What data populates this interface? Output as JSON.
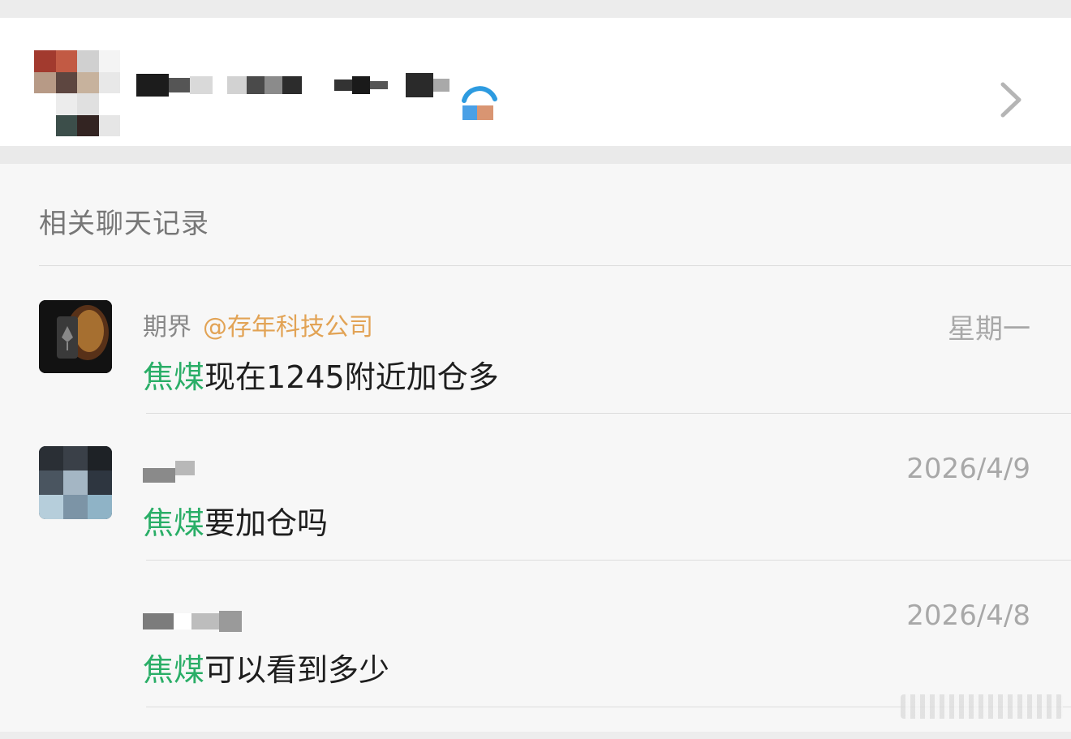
{
  "contact": {
    "name_redacted": true
  },
  "section": {
    "title": "相关聊天记录"
  },
  "results": [
    {
      "sender": "期界",
      "mention": "@存年科技公司",
      "time": "星期一",
      "keyword": "焦煤",
      "message": "现在1245附近加仓多"
    },
    {
      "sender": "",
      "mention": "",
      "time": "2026/4/9",
      "keyword": "焦煤",
      "message": "要加仓吗"
    },
    {
      "sender": "",
      "mention": "",
      "time": "2026/4/8",
      "keyword": "焦煤",
      "message": "可以看到多少"
    }
  ],
  "colors": {
    "highlight": "#2aae67",
    "mention": "#e2a355",
    "timestamp": "#a8a8a8"
  },
  "icons": {
    "chevron": "chevron-right-icon",
    "status": "loading-status-icon"
  }
}
